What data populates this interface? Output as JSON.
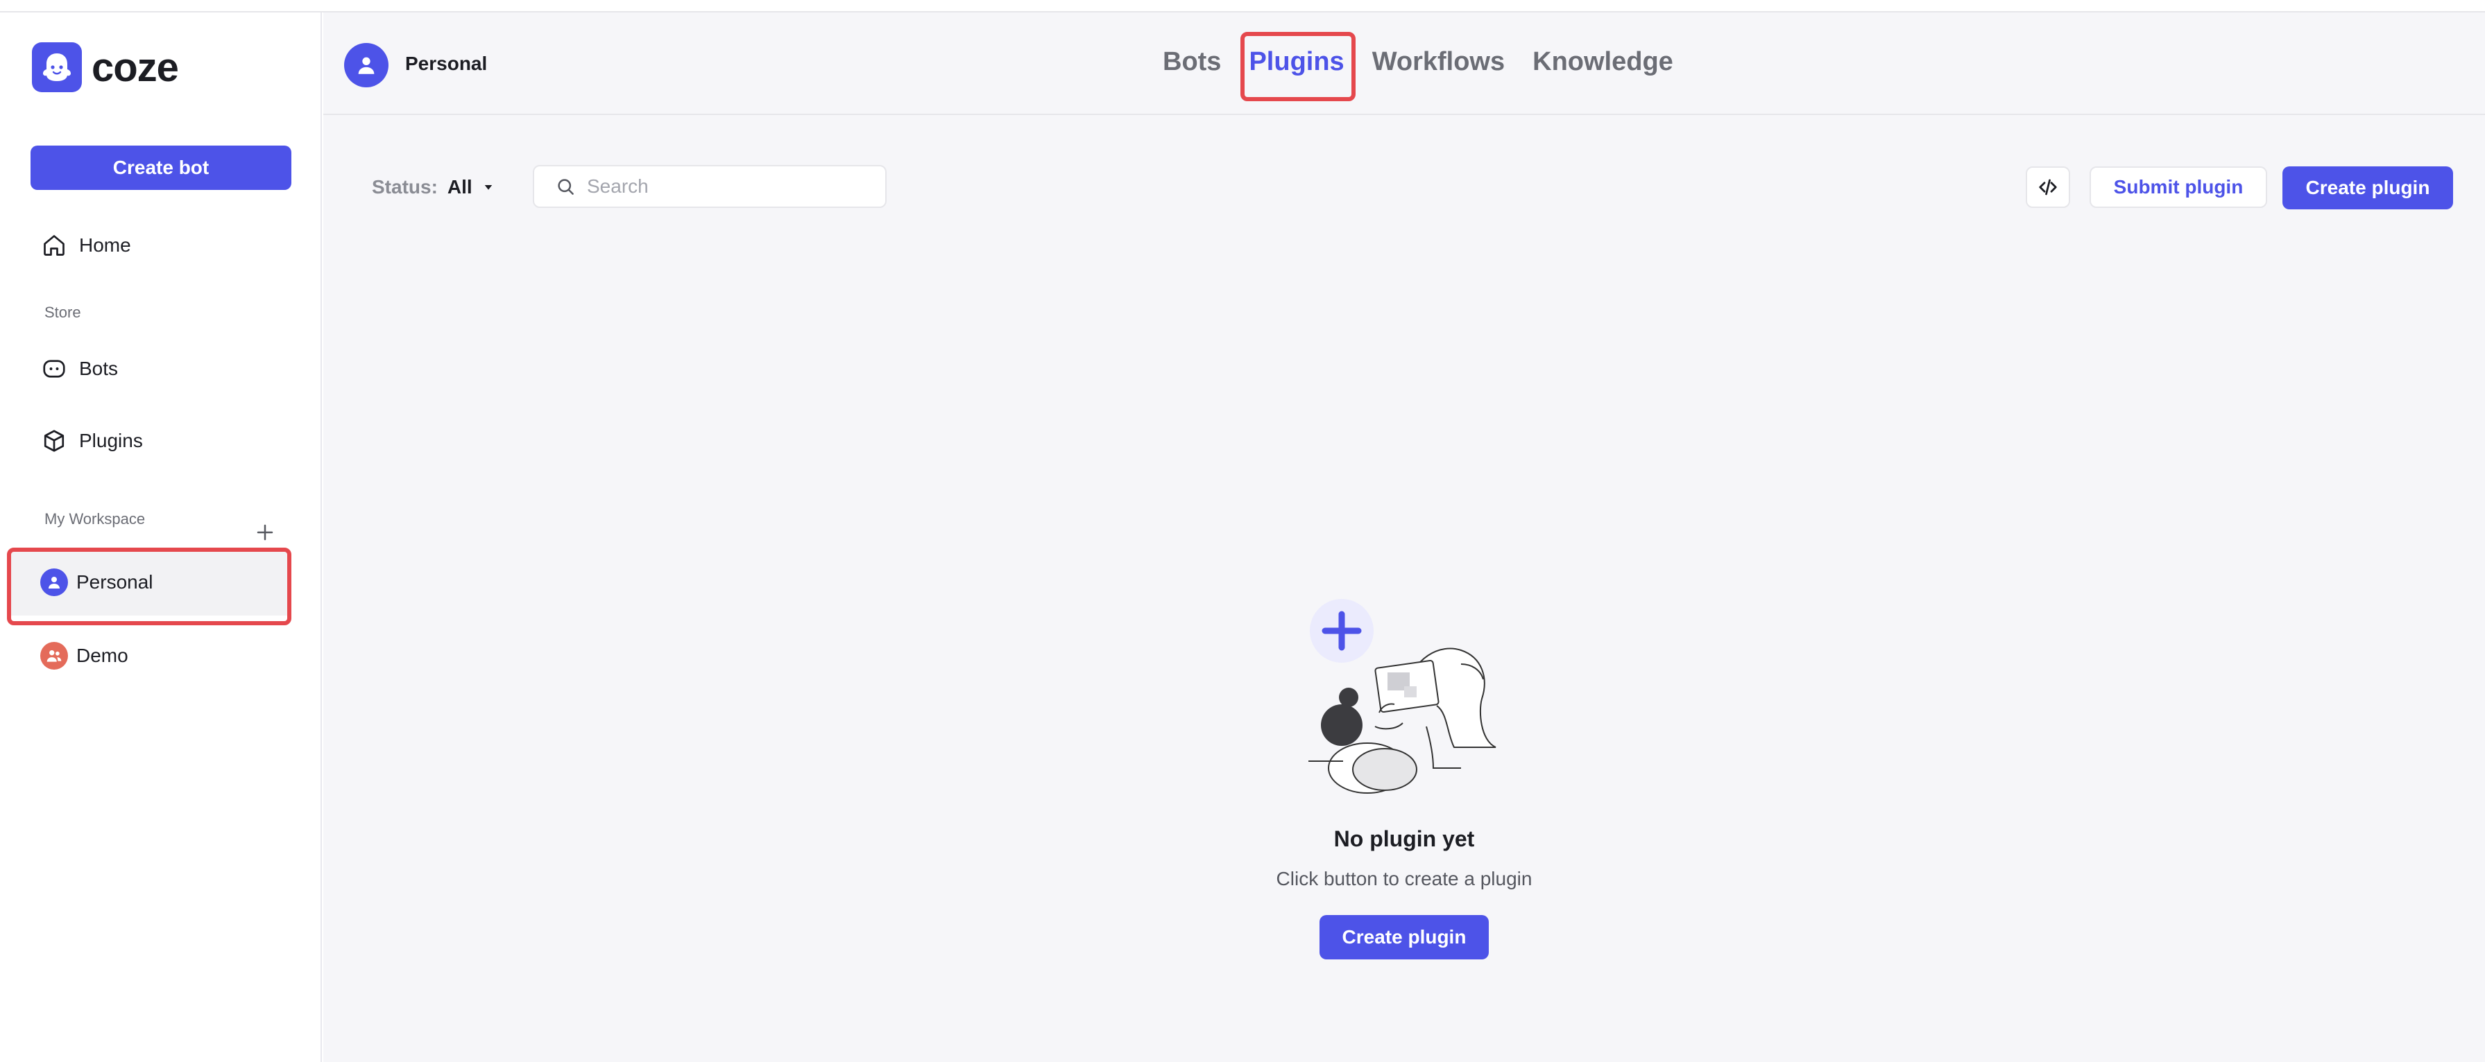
{
  "app": {
    "logo_text": "coze"
  },
  "sidebar": {
    "create_bot_label": "Create bot",
    "home_label": "Home",
    "store_section_label": "Store",
    "store_items": [
      {
        "label": "Bots",
        "icon": "bot-icon"
      },
      {
        "label": "Plugins",
        "icon": "cube-icon"
      }
    ],
    "workspace_section_label": "My Workspace",
    "workspaces": [
      {
        "label": "Personal",
        "icon": "user-icon",
        "selected": true,
        "color": "#4d53e8"
      },
      {
        "label": "Demo",
        "icon": "team-icon",
        "selected": false,
        "color": "#e46b5a"
      }
    ]
  },
  "header": {
    "space_name": "Personal",
    "tabs": [
      {
        "label": "Bots",
        "active": false
      },
      {
        "label": "Plugins",
        "active": true
      },
      {
        "label": "Workflows",
        "active": false
      },
      {
        "label": "Knowledge",
        "active": false
      }
    ]
  },
  "toolbar": {
    "status_label": "Status:",
    "status_value": "All",
    "search_placeholder": "Search",
    "submit_plugin_label": "Submit plugin",
    "create_plugin_label": "Create plugin"
  },
  "empty_state": {
    "title": "No plugin yet",
    "subtitle": "Click button to create a plugin",
    "button_label": "Create plugin"
  },
  "colors": {
    "accent": "#4d53e8",
    "highlight": "#e5484d",
    "background": "#f6f6f9"
  }
}
